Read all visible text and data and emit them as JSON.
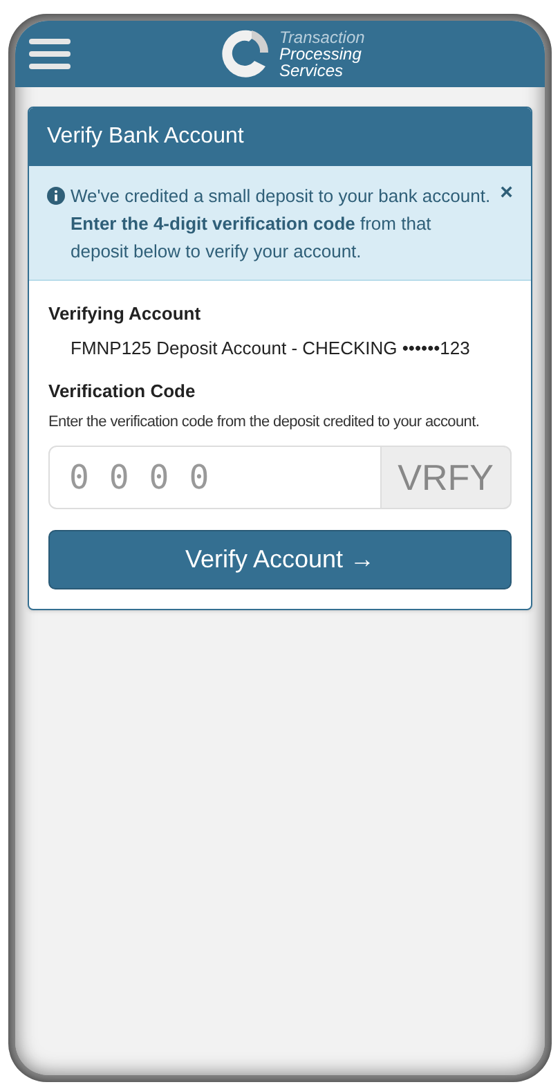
{
  "header": {
    "logo_lines": [
      "Transaction",
      "Processing",
      "Services"
    ]
  },
  "card": {
    "title": "Verify Bank Account",
    "alert": {
      "text": "We've credited a small deposit to your bank account. **Enter the 4-digit verification code** from that deposit below to verify your account.",
      "close": "×"
    },
    "account_label": "Verifying Account",
    "account_value": "FMNP125 Deposit Account - CHECKING ••••••123",
    "code_label": "Verification Code",
    "code_help": "Enter the verification code from the deposit credited to your account.",
    "code_field": {
      "placeholder": "0 0 0 0",
      "addon": "VRFY"
    },
    "button": {
      "label": "Verify Account",
      "icon": "→"
    }
  }
}
